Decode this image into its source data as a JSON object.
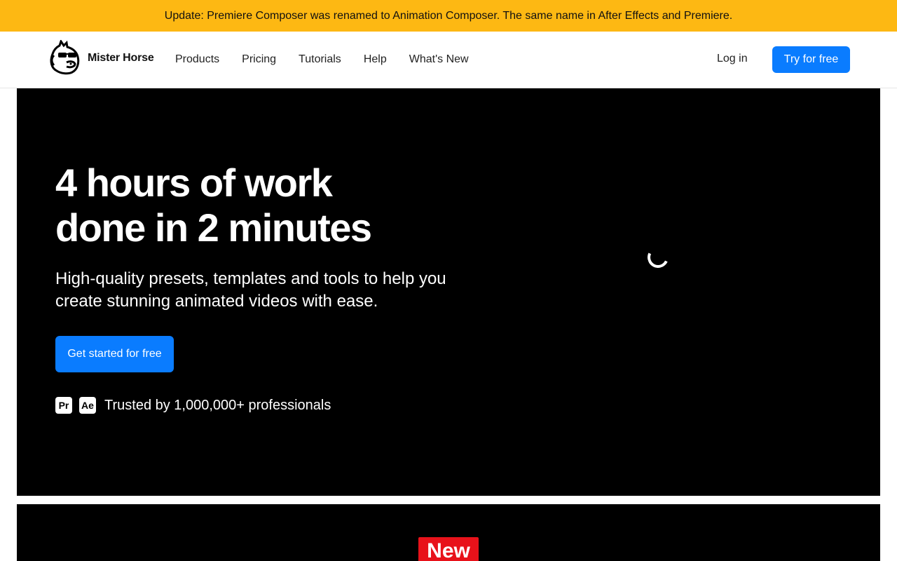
{
  "banner": {
    "text": "Update: Premiere Composer was renamed to Animation Composer. The same name in After Effects and Premiere."
  },
  "nav": {
    "brand": "Mister Horse",
    "links": [
      "Products",
      "Pricing",
      "Tutorials",
      "Help",
      "What's New"
    ],
    "login": "Log in",
    "cta": "Try for free"
  },
  "hero": {
    "title_line1": "4 hours of work",
    "title_line2": "done in 2 minutes",
    "subtitle_line1": "High-quality presets, templates and tools to help you",
    "subtitle_line2": "create stunning animated videos with ease.",
    "cta": "Get started for free",
    "badges": [
      "Pr",
      "Ae"
    ],
    "trust": "Trusted by 1,000,000+ professionals"
  },
  "section2": {
    "badge": "New"
  },
  "colors": {
    "banner": "#fdb813",
    "accent": "#0a7cff",
    "hero_bg": "#000000",
    "new_badge": "#e8121a"
  }
}
